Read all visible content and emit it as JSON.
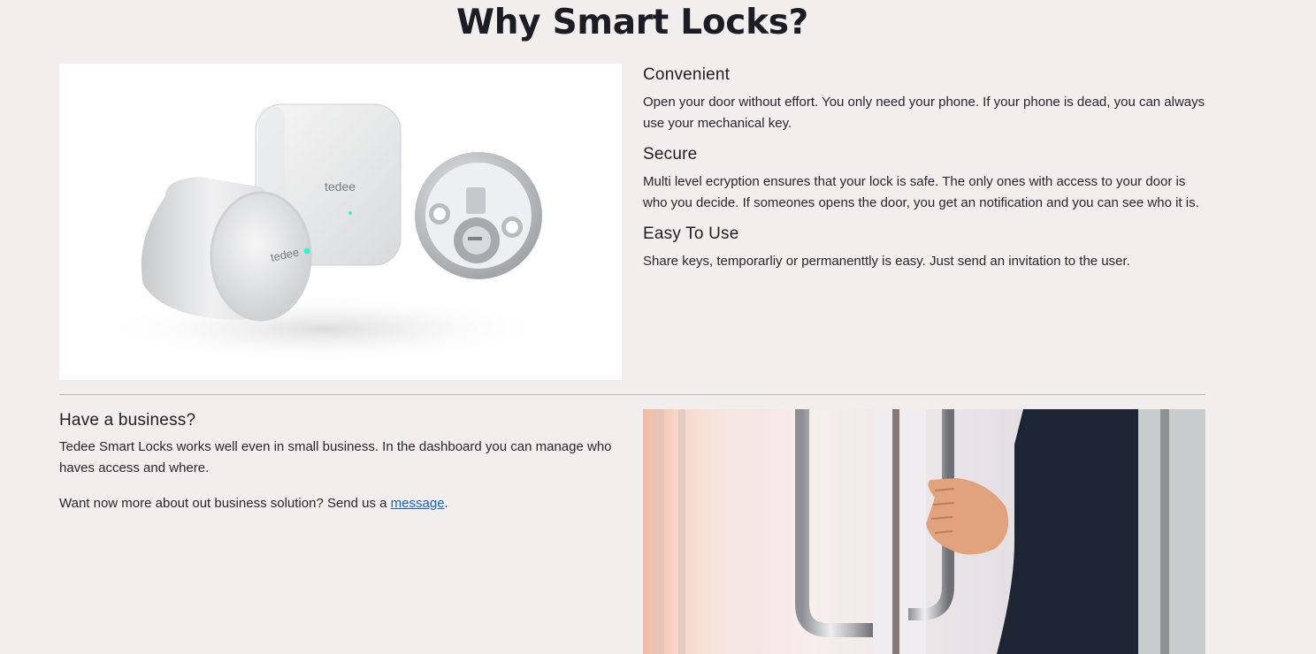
{
  "page": {
    "title": "Why Smart Locks?"
  },
  "product_image": {
    "brand_text": "tedee",
    "alt": "tedee smart lock product"
  },
  "features": [
    {
      "title": "Convenient",
      "text": "Open your door without effort. You only need your phone. If your phone is dead, you can always use your mechanical key."
    },
    {
      "title": "Secure",
      "text": "Multi level ecryption ensures that your lock is safe. The only ones with access to your door is who you decide. If someones opens the door, you get an notification and you can see who it is."
    },
    {
      "title": "Easy To Use",
      "text": "Share keys, temporarliy or permanenttly is easy. Just send an invitation to the user."
    }
  ],
  "business": {
    "title": "Have a business?",
    "text": "Tedee Smart Locks works well even in small business. In the dashboard you can manage who haves access and where.",
    "cta_prefix": "Want now more about out business solution? Send us a ",
    "cta_link": "message",
    "cta_suffix": "."
  },
  "colors": {
    "background": "#f2eeed",
    "link": "#1a5fd0",
    "accent_led": "#3ef0c8"
  }
}
